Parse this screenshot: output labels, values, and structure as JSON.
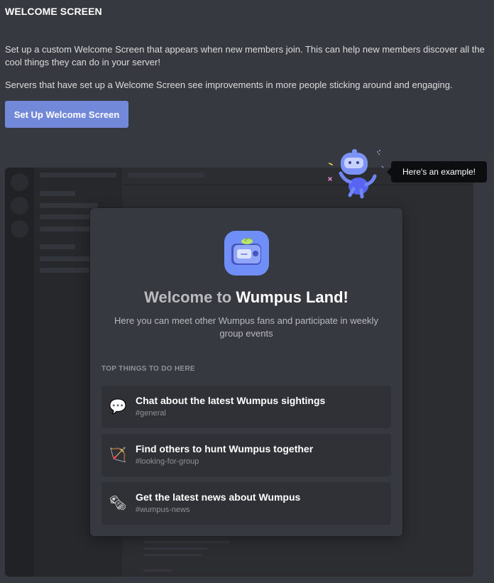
{
  "page": {
    "title": "WELCOME SCREEN",
    "description_1": "Set up a custom Welcome Screen that appears when new members join. This can help new members discover all the cool things they can do in your server!",
    "description_2": "Servers that have set up a Welcome Screen see improvements in more people sticking around and engaging.",
    "setup_button": "Set Up Welcome Screen"
  },
  "tooltip": {
    "text": "Here's an example!"
  },
  "welcome": {
    "title_prefix": "Welcome to",
    "server_name": "Wumpus Land!",
    "description": "Here you can meet other Wumpus fans and participate in weekly group events",
    "section_label": "TOP THINGS TO DO HERE",
    "items": [
      {
        "emoji": "💬",
        "icon": "speech-bubble-icon",
        "title": "Chat about the latest Wumpus sightings",
        "channel": "#general"
      },
      {
        "emoji": "🏹",
        "icon": "bow-and-arrow-icon",
        "title": "Find others to hunt Wumpus together",
        "channel": "#looking-for-group"
      },
      {
        "emoji": "🗞",
        "icon": "newspaper-icon",
        "title": "Get the latest news about Wumpus",
        "channel": "#wumpus-news"
      }
    ]
  },
  "colors": {
    "background": "#36393f",
    "accent": "#7289da",
    "tooltip": "#0c0d0f",
    "card": "#2f3136",
    "server_icon": "#6f8ef7"
  }
}
